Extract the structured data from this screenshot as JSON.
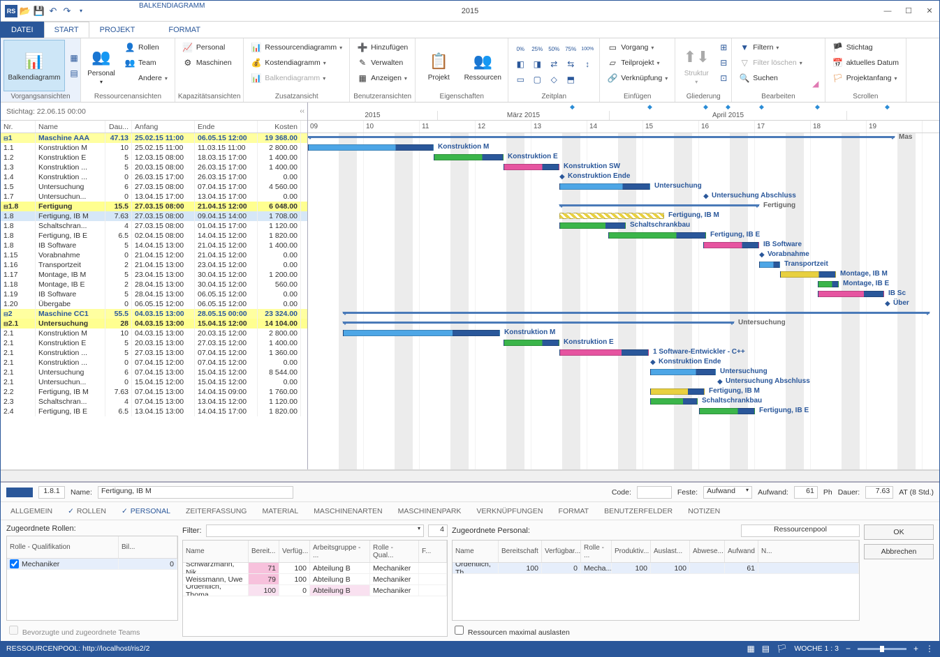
{
  "title": "2015",
  "context_tab": "BALKENDIAGRAMM",
  "menu": {
    "file": "DATEI",
    "start": "START",
    "projekt": "PROJEKT",
    "format": "FORMAT"
  },
  "ribbon": {
    "g1": {
      "label": "Vorgangsansichten",
      "btn": "Balkendiagramm"
    },
    "g2": {
      "label": "Ressourcenansichten",
      "personal": "Personal",
      "andere": "Andere",
      "rollen": "Rollen",
      "team": "Team",
      "maschinen": "Maschinen"
    },
    "g3": {
      "label": "Kapazitätsansichten",
      "personal": "Personal",
      "maschinen": "Maschinen"
    },
    "g4": {
      "label": "Zusatzansicht",
      "ress": "Ressourcendiagramm",
      "kost": "Kostendiagramm",
      "balk": "Balkendiagramm"
    },
    "g5": {
      "label": "Benutzeransichten",
      "hinz": "Hinzufügen",
      "verw": "Verwalten",
      "anz": "Anzeigen"
    },
    "g6": {
      "label": "Eigenschaften",
      "proj": "Projekt",
      "res": "Ressourcen"
    },
    "g7": {
      "label": "Zeitplan"
    },
    "g8": {
      "label": "Einfügen",
      "vor": "Vorgang",
      "teil": "Teilprojekt",
      "verk": "Verknüpfung"
    },
    "g9": {
      "label": "Gliederung",
      "struk": "Struktur"
    },
    "g10": {
      "label": "Bearbeiten",
      "filtern": "Filtern",
      "loeschen": "Filter löschen",
      "suchen": "Suchen"
    },
    "g11": {
      "label": "Scrollen",
      "stichtag": "Stichtag",
      "aktuell": "aktuelles Datum",
      "projanf": "Projektanfang"
    }
  },
  "stichtag": "Stichtag: 22.06.15 00:00",
  "grid_headers": {
    "nr": "Nr.",
    "name": "Name",
    "dau": "Dau...",
    "anfang": "Anfang",
    "ende": "Ende",
    "kosten": "Kosten"
  },
  "timeline": {
    "top_year": "2015",
    "month1": "März 2015",
    "month2": "April 2015",
    "days": [
      "09",
      "10",
      "11",
      "12",
      "13",
      "14",
      "15",
      "16",
      "17",
      "18",
      "19"
    ]
  },
  "bar_labels": {
    "mas": "Mas",
    "konstr_m": "Konstruktion M",
    "konstr_e": "Konstruktion E",
    "konstr_sw": "Konstruktion SW",
    "konstr_end": "Konstruktion Ende",
    "unters": "Untersuchung",
    "unters_abs": "Untersuchung Abschluss",
    "fertigung": "Fertigung",
    "fert_ibm": "Fertigung, IB M",
    "schalt": "Schaltschrankbau",
    "fert_ibe": "Fertigung, IB E",
    "ibsw": "IB Software",
    "vorab": "Vorabnahme",
    "transp": "Transportzeit",
    "mont_ibm": "Montage, IB M",
    "mont_ibe": "Montage, IB E",
    "ibsc": "IB Sc",
    "ueber": "Über",
    "sw_entw": "1 Software-Entwickler - C++"
  },
  "rows": [
    {
      "nr": "1",
      "name": "Maschine AAA",
      "dau": "47.13",
      "anf": "25.02.15 11:00",
      "end": "06.05.15 12:00",
      "kost": "19 368.00",
      "t": "s1"
    },
    {
      "nr": "1.1",
      "name": "Konstruktion M",
      "dau": "10",
      "anf": "25.02.15 11:00",
      "end": "11.03.15 11:00",
      "kost": "2 800.00"
    },
    {
      "nr": "1.2",
      "name": "Konstruktion E",
      "dau": "5",
      "anf": "12.03.15 08:00",
      "end": "18.03.15 17:00",
      "kost": "1 400.00"
    },
    {
      "nr": "1.3",
      "name": "Konstruktion ...",
      "dau": "5",
      "anf": "20.03.15 08:00",
      "end": "26.03.15 17:00",
      "kost": "1 400.00"
    },
    {
      "nr": "1.4",
      "name": "Konstruktion ...",
      "dau": "0",
      "anf": "26.03.15 17:00",
      "end": "26.03.15 17:00",
      "kost": "0.00"
    },
    {
      "nr": "1.5",
      "name": "Untersuchung",
      "dau": "6",
      "anf": "27.03.15 08:00",
      "end": "07.04.15 17:00",
      "kost": "4 560.00"
    },
    {
      "nr": "1.7",
      "name": "Untersuchun...",
      "dau": "0",
      "anf": "13.04.15 17:00",
      "end": "13.04.15 17:00",
      "kost": "0.00"
    },
    {
      "nr": "1.8",
      "name": "Fertigung",
      "dau": "15.5",
      "anf": "27.03.15 08:00",
      "end": "21.04.15 12:00",
      "kost": "6 048.00",
      "t": "s2"
    },
    {
      "nr": "1.8",
      "name": "Fertigung, IB M",
      "dau": "7.63",
      "anf": "27.03.15 08:00",
      "end": "09.04.15 14:00",
      "kost": "1 708.00",
      "sel": true
    },
    {
      "nr": "1.8",
      "name": "Schaltschran...",
      "dau": "4",
      "anf": "27.03.15 08:00",
      "end": "01.04.15 17:00",
      "kost": "1 120.00"
    },
    {
      "nr": "1.8",
      "name": "Fertigung, IB E",
      "dau": "6.5",
      "anf": "02.04.15 08:00",
      "end": "14.04.15 12:00",
      "kost": "1 820.00"
    },
    {
      "nr": "1.8",
      "name": "IB Software",
      "dau": "5",
      "anf": "14.04.15 13:00",
      "end": "21.04.15 12:00",
      "kost": "1 400.00"
    },
    {
      "nr": "1.15",
      "name": "Vorabnahme",
      "dau": "0",
      "anf": "21.04.15 12:00",
      "end": "21.04.15 12:00",
      "kost": "0.00"
    },
    {
      "nr": "1.16",
      "name": "Transportzeit",
      "dau": "2",
      "anf": "21.04.15 13:00",
      "end": "23.04.15 12:00",
      "kost": "0.00"
    },
    {
      "nr": "1.17",
      "name": "Montage, IB M",
      "dau": "5",
      "anf": "23.04.15 13:00",
      "end": "30.04.15 12:00",
      "kost": "1 200.00"
    },
    {
      "nr": "1.18",
      "name": "Montage, IB E",
      "dau": "2",
      "anf": "28.04.15 13:00",
      "end": "30.04.15 12:00",
      "kost": "560.00"
    },
    {
      "nr": "1.19",
      "name": "IB Software",
      "dau": "5",
      "anf": "28.04.15 13:00",
      "end": "06.05.15 12:00",
      "kost": "0.00"
    },
    {
      "nr": "1.20",
      "name": "Übergabe",
      "dau": "0",
      "anf": "06.05.15 12:00",
      "end": "06.05.15 12:00",
      "kost": "0.00"
    },
    {
      "nr": "2",
      "name": "Maschine CC1",
      "dau": "55.5",
      "anf": "04.03.15 13:00",
      "end": "28.05.15 00:00",
      "kost": "23 324.00",
      "t": "s1"
    },
    {
      "nr": "2.1",
      "name": "Untersuchung",
      "dau": "28",
      "anf": "04.03.15 13:00",
      "end": "15.04.15 12:00",
      "kost": "14 104.00",
      "t": "s2"
    },
    {
      "nr": "2.1",
      "name": "Konstruktion M",
      "dau": "10",
      "anf": "04.03.15 13:00",
      "end": "20.03.15 12:00",
      "kost": "2 800.00"
    },
    {
      "nr": "2.1",
      "name": "Konstruktion E",
      "dau": "5",
      "anf": "20.03.15 13:00",
      "end": "27.03.15 12:00",
      "kost": "1 400.00"
    },
    {
      "nr": "2.1",
      "name": "Konstruktion ...",
      "dau": "5",
      "anf": "27.03.15 13:00",
      "end": "07.04.15 12:00",
      "kost": "1 360.00"
    },
    {
      "nr": "2.1",
      "name": "Konstruktion ...",
      "dau": "0",
      "anf": "07.04.15 12:00",
      "end": "07.04.15 12:00",
      "kost": "0.00"
    },
    {
      "nr": "2.1",
      "name": "Untersuchung",
      "dau": "6",
      "anf": "07.04.15 13:00",
      "end": "15.04.15 12:00",
      "kost": "8 544.00"
    },
    {
      "nr": "2.1",
      "name": "Untersuchun...",
      "dau": "0",
      "anf": "15.04.15 12:00",
      "end": "15.04.15 12:00",
      "kost": "0.00"
    },
    {
      "nr": "2.2",
      "name": "Fertigung, IB M",
      "dau": "7.63",
      "anf": "07.04.15 13:00",
      "end": "14.04.15 09:00",
      "kost": "1 760.00"
    },
    {
      "nr": "2.3",
      "name": "Schaltschran...",
      "dau": "4",
      "anf": "07.04.15 13:00",
      "end": "13.04.15 12:00",
      "kost": "1 120.00"
    },
    {
      "nr": "2.4",
      "name": "Fertigung, IB E",
      "dau": "6.5",
      "anf": "13.04.15 13:00",
      "end": "14.04.15 17:00",
      "kost": "1 820.00"
    }
  ],
  "detail": {
    "id": "1.8.1",
    "name_lbl": "Name:",
    "name": "Fertigung, IB M",
    "code_lbl": "Code:",
    "feste_lbl": "Feste:",
    "feste": "Aufwand",
    "aufwand_lbl": "Aufwand:",
    "aufwand": "61",
    "ph": "Ph",
    "dauer_lbl": "Dauer:",
    "dauer": "7.63",
    "at": "AT (8 Std.)",
    "tabs": [
      "ALLGEMEIN",
      "ROLLEN",
      "PERSONAL",
      "ZEITERFASSUNG",
      "MATERIAL",
      "MASCHINENARTEN",
      "MASCHINENPARK",
      "VERKNÜPFUNGEN",
      "FORMAT",
      "BENUTZERFELDER",
      "NOTIZEN"
    ],
    "rollen_lbl": "Zugeordnete Rollen:",
    "filter_lbl": "Filter:",
    "filter_count": "4",
    "personal_lbl": "Zugeordnete Personal:",
    "pool_btn": "Ressourcenpool",
    "ok": "OK",
    "cancel": "Abbrechen",
    "teams_chk": "Bevorzugte und zugeordnete Teams",
    "max_chk": "Ressourcen maximal auslasten",
    "rollen_head": {
      "c1": "Rolle - Qualifikation",
      "c2": "Bil..."
    },
    "rollen_rows": [
      {
        "c1": "Mechaniker",
        "c2": "0"
      }
    ],
    "avail_head": {
      "c1": "Name",
      "c2": "Bereit...",
      "c3": "Verfüg...",
      "c4": "Arbeitsgruppe - ...",
      "c5": "Rolle - Qual...",
      "c6": "F..."
    },
    "avail_rows": [
      {
        "c1": "Schwarzmann, Nik",
        "c2": "71",
        "c3": "100",
        "c4": "Abteilung B",
        "c5": "Mechaniker",
        "hl": "pink"
      },
      {
        "c1": "Weissmann, Uwe",
        "c2": "79",
        "c3": "100",
        "c4": "Abteilung B",
        "c5": "Mechaniker",
        "hl": "pink"
      },
      {
        "c1": "Ordentlich, Thoma",
        "c2": "100",
        "c3": "0",
        "c4": "Abteilung B",
        "c5": "Mechaniker",
        "hl": "pink2"
      }
    ],
    "assign_head": {
      "c1": "Name",
      "c2": "Bereitschaft",
      "c3": "Verfügbar...",
      "c4": "Rolle - ...",
      "c5": "Produktiv...",
      "c6": "Auslast...",
      "c7": "Abwese...",
      "c8": "Aufwand",
      "c9": "N..."
    },
    "assign_rows": [
      {
        "c1": "Ordentlich, Th",
        "c2": "100",
        "c3": "0",
        "c4": "Mecha...",
        "c5": "100",
        "c6": "100",
        "c7": "",
        "c8": "61",
        "c9": ""
      }
    ]
  },
  "status": {
    "left": "RESSOURCENPOOL: http://localhost/ris2/2",
    "woche": "WOCHE 1 : 3"
  }
}
